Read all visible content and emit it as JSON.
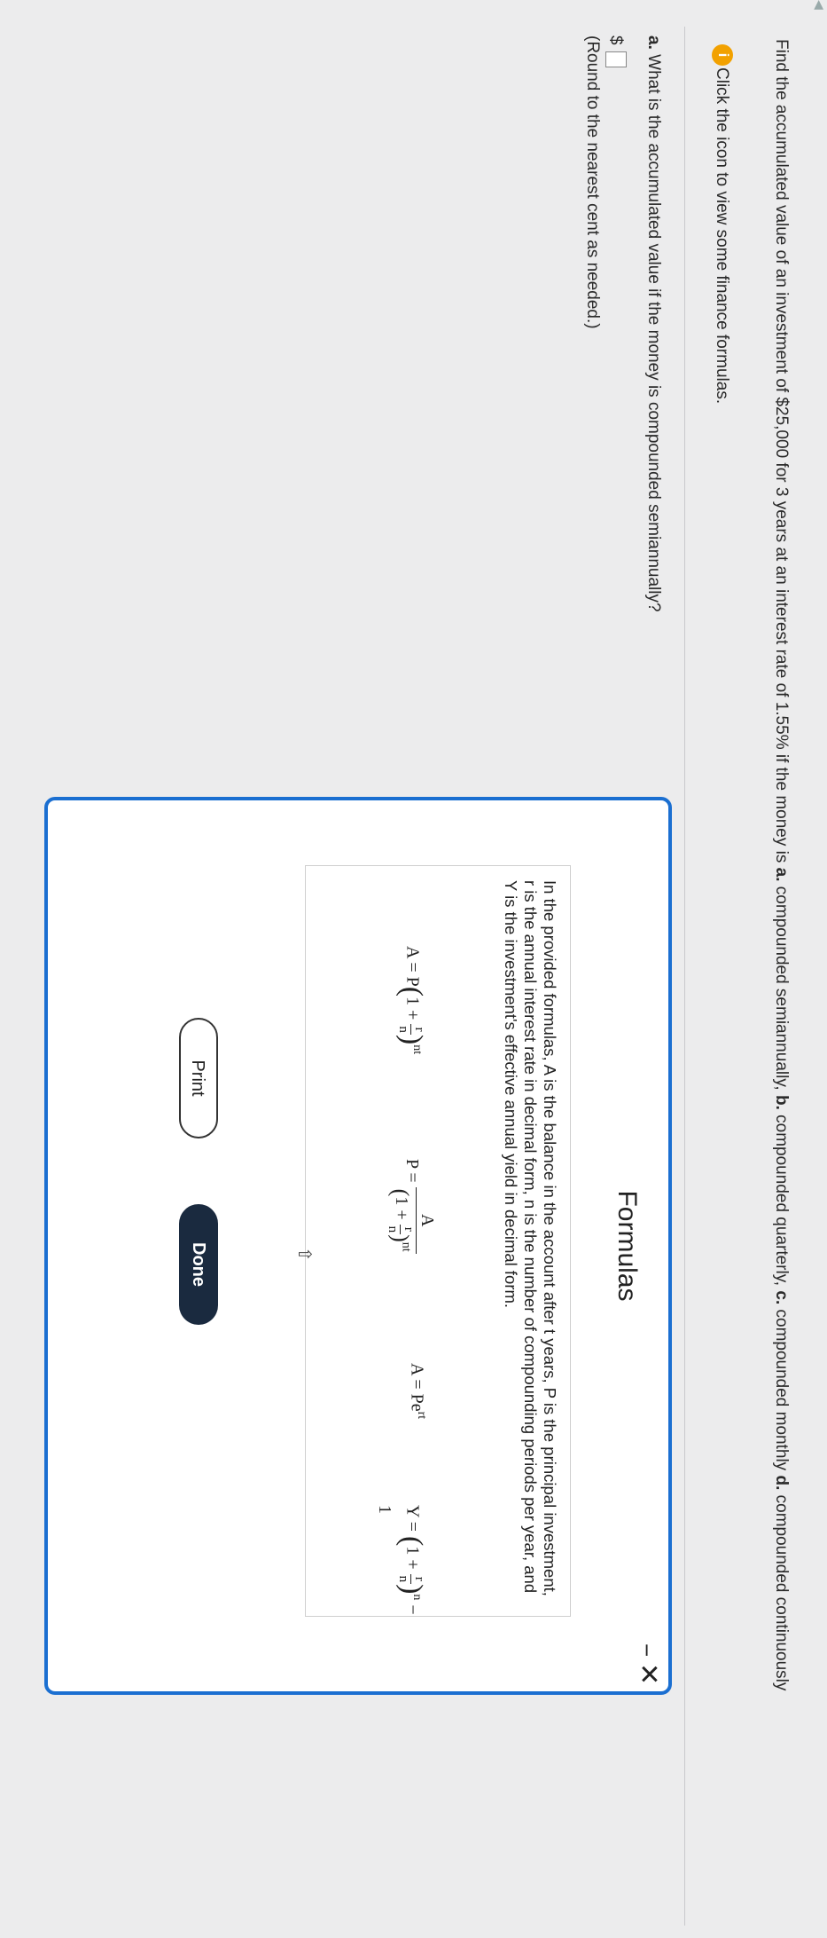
{
  "question": {
    "text_1": "Find the accumulated value of an investment of $25,000 for 3 years at an interest rate of 1.55% if the money is ",
    "label_a": "a.",
    "text_2": " compounded semiannually, ",
    "label_b": "b.",
    "text_3": " compounded quarterly, ",
    "label_c": "c.",
    "text_4": " compounded monthly ",
    "label_d": "d.",
    "text_5": " compounded continuously"
  },
  "hint": {
    "icon": "i",
    "text": "Click the icon to view some finance formulas."
  },
  "part_a": {
    "label": "a.",
    "question": " What is the accumulated value if the money is compounded semiannually?",
    "currency": "$",
    "note": "(Round to the nearest cent as needed.)"
  },
  "dialog": {
    "title": "Formulas",
    "minimize": "−",
    "close": "✕",
    "description": "In the provided formulas, A is the balance in the account after t years, P is the principal investment, r is the annual interest rate in decimal form, n is the number of compounding periods per year, and Y is the investment's effective annual yield in decimal form.",
    "print_label": "Print",
    "done_label": "Done",
    "colors": {
      "border": "#1b6fd1",
      "done_bg": "#1a2a3f"
    }
  }
}
